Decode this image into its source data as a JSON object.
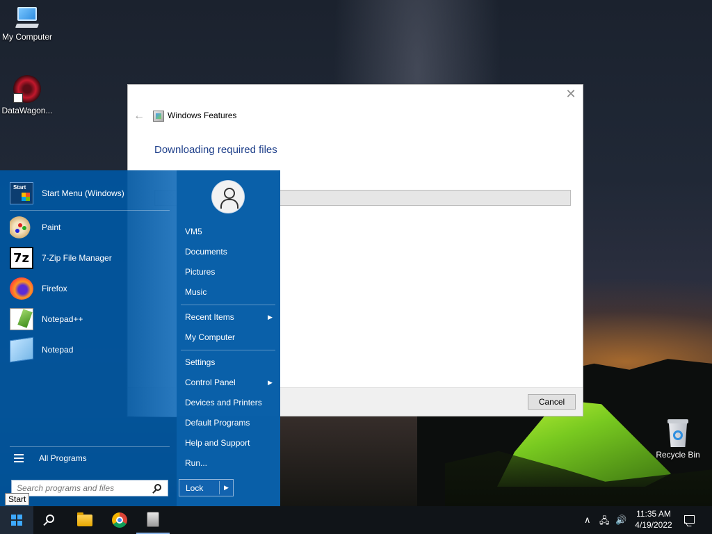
{
  "desktop": {
    "icons": [
      {
        "label": "My Computer",
        "icon": "computer-icon"
      },
      {
        "label": "DataWagon...",
        "icon": "datawagon-icon"
      },
      {
        "label": "Recycle Bin",
        "icon": "recycle-bin-icon"
      }
    ]
  },
  "dialog": {
    "title": "Windows Features",
    "back_icon": "←",
    "close_icon": "✕",
    "heading": "Downloading required files",
    "progress_fraction": 0,
    "cancel_label": "Cancel"
  },
  "start_menu": {
    "programs": [
      {
        "label": "Start Menu (Windows)",
        "icon": "start-menu-icon"
      },
      {
        "label": "Paint",
        "icon": "paint-icon"
      },
      {
        "label": "7-Zip File Manager",
        "icon": "7zip-icon"
      },
      {
        "label": "Firefox",
        "icon": "firefox-icon"
      },
      {
        "label": "Notepad++",
        "icon": "notepadpp-icon"
      },
      {
        "label": "Notepad",
        "icon": "notepad-icon"
      }
    ],
    "start_icon_text": "Start",
    "sevenzip_icon_text": "7z",
    "all_programs": "All Programs",
    "search_placeholder": "Search programs and files",
    "right_items": [
      {
        "label": "VM5"
      },
      {
        "label": "Documents"
      },
      {
        "label": "Pictures"
      },
      {
        "label": "Music"
      },
      {
        "label": "Recent Items",
        "submenu": true
      },
      {
        "label": "My Computer"
      },
      {
        "label": "Settings"
      },
      {
        "label": "Control Panel",
        "submenu": true
      },
      {
        "label": "Devices and Printers"
      },
      {
        "label": "Default Programs"
      },
      {
        "label": "Help and Support"
      },
      {
        "label": "Run..."
      }
    ],
    "submenu_arrow": "▶",
    "lock_label": "Lock"
  },
  "tooltip": {
    "text": "Start"
  },
  "taskbar": {
    "pinned": [
      "start-button",
      "search-icon",
      "file-explorer-icon",
      "chrome-icon",
      "app-icon"
    ],
    "tray": {
      "chevron": "∧",
      "network": "🖧",
      "volume": "🔊"
    },
    "clock_time": "11:35 AM",
    "clock_date": "4/19/2022"
  },
  "colors": {
    "start_menu_bg": "#0056a0",
    "dialog_heading": "#1e3f8a",
    "taskbar_bg": "#101418"
  }
}
